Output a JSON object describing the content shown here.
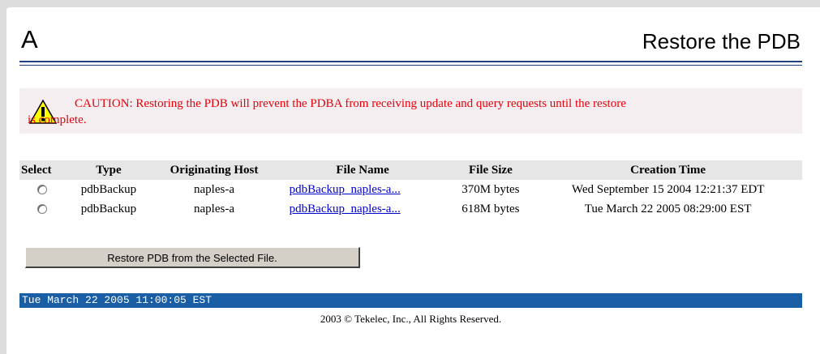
{
  "header": {
    "letter": "A",
    "title": "Restore the PDB"
  },
  "caution": {
    "icon": "warning-icon",
    "line1": "CAUTION: Restoring the PDB will prevent the PDBA from receiving update and query requests until the restore",
    "line2": "is complete."
  },
  "table": {
    "headers": [
      "Select",
      "Type",
      "Originating Host",
      "File Name",
      "File Size",
      "Creation Time"
    ],
    "rows": [
      {
        "type": "pdbBackup",
        "host": "naples-a",
        "file_name": "pdbBackup_naples-a...",
        "file_size": "370M bytes",
        "created": "Wed September 15 2004 12:21:37 EDT"
      },
      {
        "type": "pdbBackup",
        "host": "naples-a",
        "file_name": "pdbBackup_naples-a...",
        "file_size": "618M bytes",
        "created": "Tue March 22 2005 08:29:00 EST"
      }
    ]
  },
  "restore_button": "Restore PDB from the Selected File.",
  "status_bar": "Tue March 22 2005 11:00:05 EST",
  "footer": "2003 © Tekelec, Inc., All Rights Reserved.",
  "colors": {
    "caution_text": "#e8000a",
    "status_bar": "#1a5fa6",
    "rule": "#1f3f7f"
  }
}
